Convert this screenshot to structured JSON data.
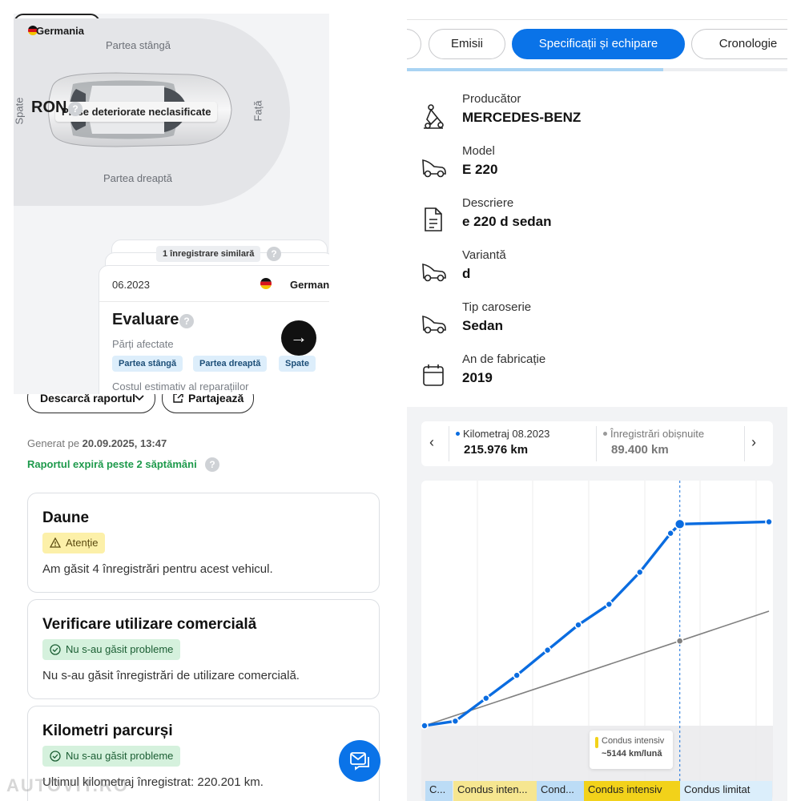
{
  "damage_map": {
    "label_left": "Partea stângă",
    "label_right": "Partea dreaptă",
    "label_back": "Spate",
    "label_front": "Față",
    "unclassified_tag": "Piese deteriorate neclasificate"
  },
  "records": {
    "left_card": {
      "country": "Germania",
      "currency": "RON"
    },
    "similar_tag": "1 înregistrare similară",
    "main_card": {
      "date": "06.2023",
      "country": "Germania",
      "title": "Evaluare",
      "affected_label": "Părți afectate",
      "chips": [
        "Partea stângă",
        "Partea dreaptă",
        "Spate"
      ],
      "repair_cost_label": "Costul estimativ al reparațiilor"
    },
    "arrow_button_icon": "arrow-right-icon"
  },
  "specs": {
    "tabs": [
      "Emisii",
      "Specificații și echipare",
      "Cronologie"
    ],
    "active_tab": "Specificații și echipare",
    "rows": [
      {
        "label": "Producător",
        "value": "MERCEDES-BENZ",
        "icon": "manufacturer-icon"
      },
      {
        "label": "Model",
        "value": "E 220",
        "icon": "car-icon"
      },
      {
        "label": "Descriere",
        "value": "e 220 d sedan",
        "icon": "document-icon"
      },
      {
        "label": "Variantă",
        "value": "d",
        "icon": "car-icon"
      },
      {
        "label": "Tip caroserie",
        "value": "Sedan",
        "icon": "car-icon"
      },
      {
        "label": "An de fabricație",
        "value": "2019",
        "icon": "calendar-icon"
      }
    ]
  },
  "report": {
    "download_label": "Descarcă raportul",
    "share_label": "Partajează",
    "generated_prefix": "Generat pe",
    "generated_date": "20.09.2025, 13:47",
    "expires_text": "Raportul expiră peste 2 săptămâni",
    "cards": {
      "damage": {
        "title": "Daune",
        "status": "Atenție",
        "text": "Am găsit 4 înregistrări pentru acest vehicul."
      },
      "commercial": {
        "title": "Verificare utilizare comercială",
        "status": "Nu s-au găsit probleme",
        "text": "Nu s-au găsit înregistrări de utilizare comercială."
      },
      "mileage": {
        "title": "Kilometri parcurși",
        "status": "Nu s-au găsit probleme",
        "text": "Ultimul kilometraj înregistrat: 220.201 km."
      }
    }
  },
  "mileage_chart": {
    "mileage_label": "Kilometraj 08.2023",
    "mileage_value": "215.976 km",
    "usual_label": "Înregistrări obișnuite",
    "usual_value": "89.400 km",
    "intense_label": "Condus intensiv",
    "intense_value": "~5144 km/lună",
    "segments": [
      "C...",
      "Condus inten...",
      "Cond...",
      "Condus intensiv",
      "Condus limitat"
    ],
    "colors": {
      "line": "#0a6ce0",
      "reference": "#808080",
      "intense": "#f2d21a",
      "normal": "#bcdcf6"
    }
  },
  "chart_data": {
    "type": "line",
    "title": "",
    "xlabel": "",
    "ylabel": "",
    "grid": true,
    "series": [
      {
        "name": "",
        "x": [
          0,
          1,
          2,
          3,
          4,
          5,
          6,
          7,
          8,
          8.3,
          11.2
        ],
        "y": [
          0,
          2,
          12,
          22,
          33,
          44,
          53,
          67,
          84,
          88,
          89
        ]
      },
      {
        "name": "Înregistrări obișnuite",
        "x": [
          0,
          8.3,
          11.2
        ],
        "y": [
          0,
          37,
          50
        ]
      }
    ],
    "xlim": [
      0,
      11.2
    ],
    "ylim": [
      0,
      100
    ],
    "highlight_x": 8.3
  },
  "watermark": "AUTOVIT.RO"
}
